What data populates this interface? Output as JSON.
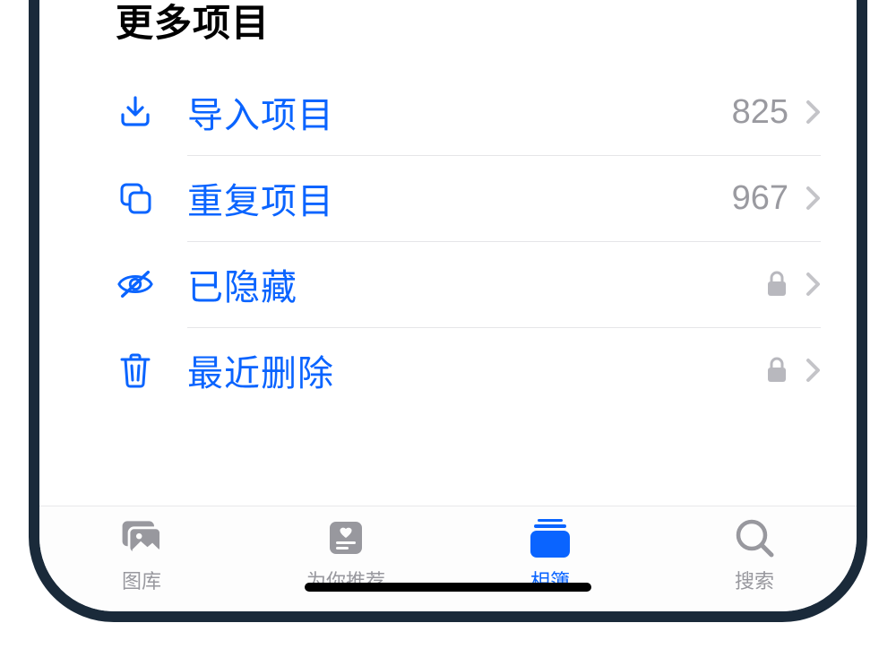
{
  "section_title": "更多项目",
  "rows": [
    {
      "label": "导入项目",
      "count": "825",
      "locked": false
    },
    {
      "label": "重复项目",
      "count": "967",
      "locked": false
    },
    {
      "label": "已隐藏",
      "count": "",
      "locked": true
    },
    {
      "label": "最近删除",
      "count": "",
      "locked": true
    }
  ],
  "tabs": {
    "library": "图库",
    "for_you": "为你推荐",
    "albums": "相簿",
    "search": "搜索"
  }
}
